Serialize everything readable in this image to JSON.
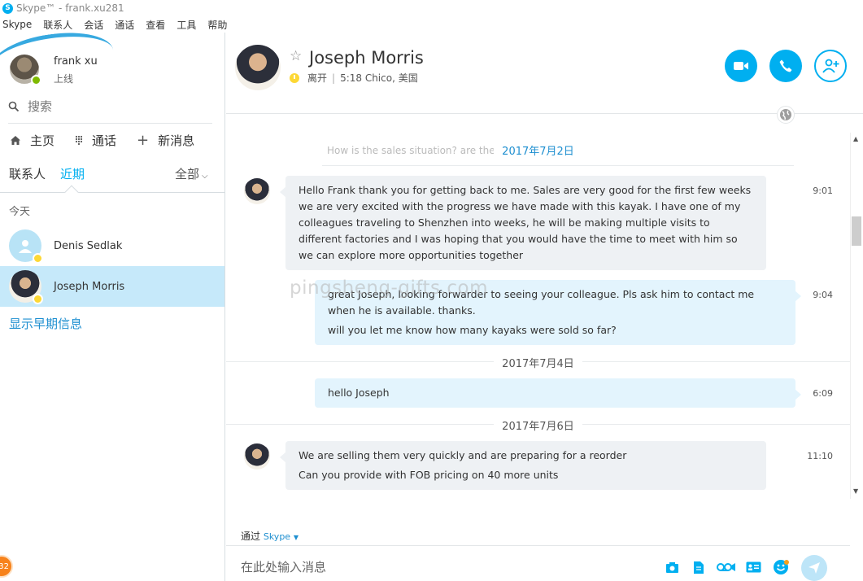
{
  "window": {
    "title": "Skype™ - frank.xu281"
  },
  "menu": [
    "Skype",
    "联系人",
    "会话",
    "通话",
    "查看",
    "工具",
    "帮助"
  ],
  "profile": {
    "name": "frank xu",
    "status": "上线"
  },
  "search": {
    "placeholder": "搜索"
  },
  "nav": {
    "home": "主页",
    "calls": "通话",
    "new_message": "新消息"
  },
  "tabs": {
    "contacts": "联系人",
    "recent": "近期",
    "filter": "全部"
  },
  "recent_section": "今天",
  "contacts": [
    {
      "name": "Denis Sedlak",
      "status": "away",
      "selected": false
    },
    {
      "name": "Joseph Morris",
      "status": "away",
      "selected": true
    }
  ],
  "show_earlier": "显示早期信息",
  "unread_badge": "32",
  "conversation": {
    "name": "Joseph Morris",
    "status": "离开",
    "local_time": "5:18 Chico, 美国",
    "faded_text": "How is the sales situation? are there",
    "watermark": "pingsheng-gifts.com",
    "days": [
      {
        "date": "2017年7月2日",
        "messages": [
          {
            "from": "Joseph Morris",
            "direction": "in",
            "time": "9:01",
            "lines": [
              "Hello Frank thank you for getting back to me. Sales are very good for the first few weeks we are very excited with the progress we have made with this kayak. I have one of my colleagues traveling to Shenzhen into weeks, he will be making multiple visits to different factories and I was hoping that you would have the time to meet with him so we can explore more opportunities together"
            ]
          },
          {
            "from": "frank xu",
            "direction": "out",
            "time": "9:04",
            "lines": [
              "great Joseph, looking forwarder to seeing your colleague. Pls ask him to contact me when he is available. thanks.",
              "will you let me know how many kayaks were sold so far?"
            ]
          }
        ]
      },
      {
        "date": "2017年7月4日",
        "messages": [
          {
            "from": "frank xu",
            "direction": "out",
            "time": "6:09",
            "lines": [
              "hello Joseph"
            ]
          }
        ]
      },
      {
        "date": "2017年7月6日",
        "messages": [
          {
            "from": "Joseph Morris",
            "direction": "in",
            "time": "11:10",
            "lines": [
              "We are selling them very quickly and are preparing for a reorder",
              "Can you provide with FOB pricing on 40 more units"
            ]
          }
        ]
      }
    ]
  },
  "composer": {
    "via_label": "通过",
    "via_service": "Skype",
    "placeholder": "在此处输入消息"
  },
  "colors": {
    "accent": "#00aff0",
    "selected_row": "#c6e9fa",
    "incoming_bubble": "#eef1f4",
    "outgoing_bubble": "#e3f4fd",
    "away": "#fdd835",
    "online": "#7fba00"
  }
}
